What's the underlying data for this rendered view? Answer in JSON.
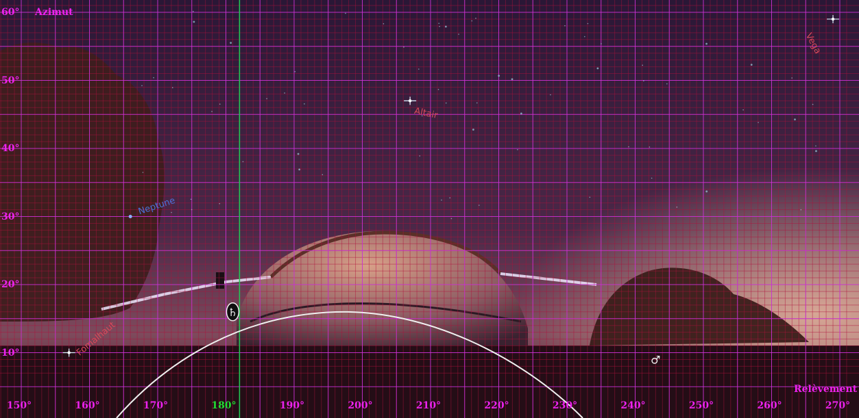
{
  "view": {
    "azimuth_range": [
      150,
      270
    ],
    "altitude_range": [
      7,
      61
    ],
    "grid": true,
    "fine_grid": true
  },
  "labels": {
    "azimut": "Azimut",
    "relevement": "Relèvement"
  },
  "altitude_ticks": [
    "60°",
    "50°",
    "40°",
    "30°",
    "20°",
    "10°"
  ],
  "azimuth_ticks": [
    "150°",
    "160°",
    "170°",
    "180°",
    "190°",
    "200°",
    "210°",
    "220°",
    "230°",
    "240°",
    "250°",
    "260°",
    "270°"
  ],
  "bodies": [
    {
      "name": "Vega",
      "az": 269,
      "alt": 59,
      "color": "#d64a5a",
      "icon": "star-icon"
    },
    {
      "name": "Altair",
      "az": 207,
      "alt": 47,
      "color": "#d64a5a",
      "icon": "star-icon"
    },
    {
      "name": "Neptune",
      "az": 166,
      "alt": 30,
      "color": "#4a72d8",
      "icon": "planet-icon"
    },
    {
      "name": "Fomalhaut",
      "az": 157,
      "alt": 10,
      "color": "#d64a5a",
      "icon": "star-icon"
    }
  ],
  "markers": [
    {
      "name": "Saturn",
      "symbol": "♄",
      "az": 181,
      "alt": 16
    },
    {
      "name": "Mars",
      "symbol": "♂",
      "az": 243,
      "alt": 9
    }
  ],
  "colors": {
    "grid": "#cc33dd",
    "fine_grid": "#b0103c",
    "meridian": "#22cc55",
    "label": "#ee22ee",
    "meridian_label": "#22dd33"
  }
}
